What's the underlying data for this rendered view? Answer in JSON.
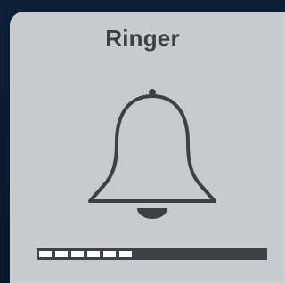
{
  "hud": {
    "title": "Ringer",
    "icon": "bell-icon",
    "volume": {
      "filled_segments": 6,
      "total_segments": 16,
      "fill_color": "#ffffff",
      "track_color": "#3e4145"
    }
  },
  "colors": {
    "panel": "#c8cacd",
    "icon": "#3d4043",
    "background": "#0b1a2e"
  }
}
